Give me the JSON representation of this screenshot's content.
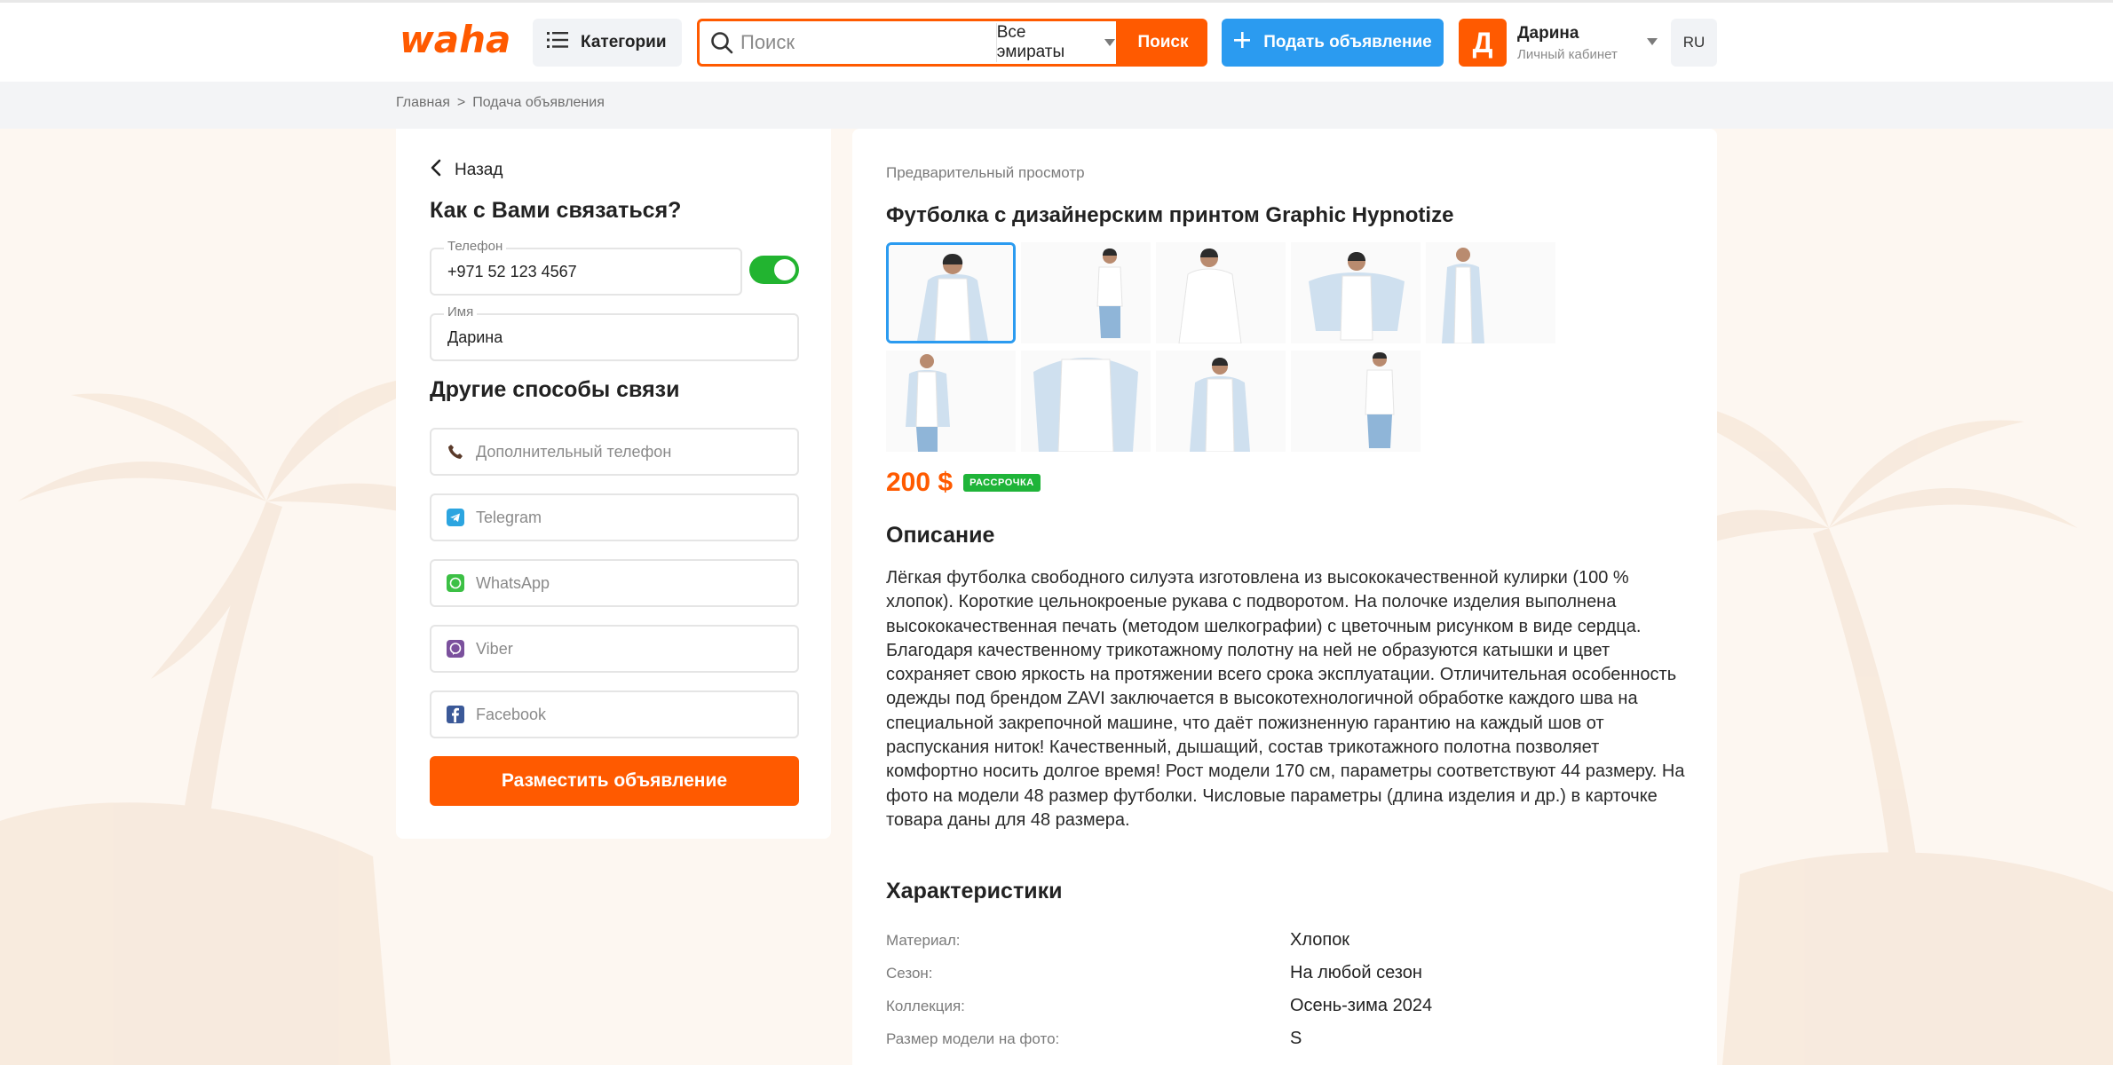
{
  "header": {
    "logo_text": "waha",
    "categories_label": "Категории",
    "search_placeholder": "Поиск",
    "region_selected": "Все эмираты",
    "search_button": "Поиск",
    "post_ad_button": "Подать объявление",
    "user_initial": "Д",
    "user_name": "Дарина",
    "user_subtitle": "Личный кабинет",
    "language": "RU",
    "accent_color": "#ff5a00",
    "blue_color": "#2b9bf0"
  },
  "breadcrumb": {
    "home": "Главная",
    "separator": ">",
    "current": "Подача объявления"
  },
  "form": {
    "back_label": "Назад",
    "contact_heading": "Как с Вами связаться?",
    "phone_label": "Телефон",
    "phone_value": "+971 52 123 4567",
    "phone_toggle_on": true,
    "name_label": "Имя",
    "name_value": "Дарина",
    "other_heading": "Другие способы связи",
    "extra_fields": [
      {
        "icon": "phone-icon",
        "placeholder": "Дополнительный телефон"
      },
      {
        "icon": "telegram-icon",
        "placeholder": "Telegram"
      },
      {
        "icon": "whatsapp-icon",
        "placeholder": "WhatsApp"
      },
      {
        "icon": "viber-icon",
        "placeholder": "Viber"
      },
      {
        "icon": "facebook-icon",
        "placeholder": "Facebook"
      }
    ],
    "submit_button": "Разместить объявление"
  },
  "preview": {
    "label": "Предварительный просмотр",
    "title": "Футболка с дизайнерским принтом Graphic Hypnotize",
    "photo_count": 9,
    "selected_photo": 1,
    "price": "200 $",
    "installment_badge": "РАССРОЧКА",
    "description_heading": "Описание",
    "description": "Лёгкая футболка свободного силуэта изготовлена из высококачественной кулирки (100 % хлопок). Короткие цельнокроеные рукава с подворотом. На полочке изделия выполнена высококачественная печать (методом шелкографии) с цветочным рисунком в виде сердца. Благодаря качественному трикотажному полотну на ней не образуются катышки и цвет сохраняет свою яркость на протяжении всего срока эксплуатации. Отличительная особенность одежды под брендом ZAVI заключается в высокотехнологичной обработке каждого шва на специальной закрепочной машине, что даёт пожизненную гарантию на каждый шов от распускания ниток! Качественный, дышащий, состав трикотажного полотна позволяет комфортно носить долгое время! Рост модели 170 см, параметры соответствуют 44 размеру. На фото на модели 48 размер футболки. Числовые параметры (длина изделия и др.) в карточке товара даны для 48 размера.",
    "characteristics_heading": "Характеристики",
    "characteristics": [
      {
        "key": "Материал:",
        "value": "Хлопок"
      },
      {
        "key": "Сезон:",
        "value": "На любой сезон"
      },
      {
        "key": "Коллекция:",
        "value": "Осень-зима 2024"
      },
      {
        "key": "Размер модели на фото:",
        "value": "S"
      }
    ]
  }
}
